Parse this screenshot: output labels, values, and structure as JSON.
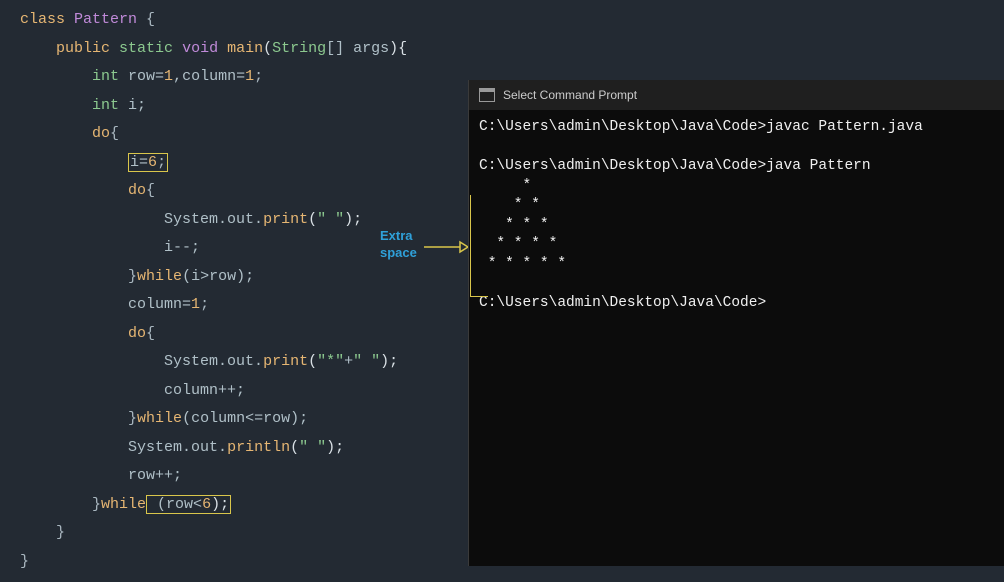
{
  "code": {
    "lines": {
      "l1_class": "class",
      "l1_name": "Pattern",
      "l1_brace": " {",
      "l2_public": "public",
      "l2_static": "static",
      "l2_void": "void",
      "l2_main": "main",
      "l2_arg_type": "String",
      "l2_arg_name": "[] args",
      "l3_int1": "int",
      "l3_vars": " row=",
      "l3_n1": "1",
      "l3_c": ",column=",
      "l3_n2": "1",
      "l3_semi": ";",
      "l4_int": "int",
      "l4_i": " i;",
      "l5_do": "do",
      "l5_brace": "{",
      "l6_assign": "i=",
      "l6_val": "6",
      "l6_semi": ";",
      "l7_do": "do",
      "l7_brace": "{",
      "l8_sys": "System.out.",
      "l8_print": "print",
      "l8_open": "(",
      "l8_str": "\" \"",
      "l8_close": ");",
      "l9_dec": "i--;",
      "l10_brace": "}",
      "l10_while": "while",
      "l10_cond": "(i>row);",
      "l11_col": "column=",
      "l11_n": "1",
      "l11_semi": ";",
      "l12_do": "do",
      "l12_brace": "{",
      "l13_sys": "System.out.",
      "l13_print": "print",
      "l13_open": "(",
      "l13_str1": "\"*\"",
      "l13_plus": "+",
      "l13_str2": "\" \"",
      "l13_close": ");",
      "l14_inc": "column++;",
      "l15_brace": "}",
      "l15_while": "while",
      "l15_cond": "(column<=row);",
      "l16_sys": "System.out.",
      "l16_println": "println",
      "l16_open": "(",
      "l16_str": "\" \"",
      "l16_close": ");",
      "l17_inc": "row++;",
      "l18_brace": "}",
      "l18_while": "while",
      "l18_cond": " (row<",
      "l18_n": "6",
      "l18_close": ");",
      "l19_brace": "}",
      "l20_brace": "}"
    }
  },
  "annotation": {
    "label_line1": "Extra",
    "label_line2": "space"
  },
  "terminal": {
    "title": "Select Command Prompt",
    "prompt_path": "C:\\Users\\admin\\Desktop\\Java\\Code>",
    "cmd1": "javac Pattern.java",
    "cmd2": "java Pattern",
    "out_line1": "     *",
    "out_line2": "    * *",
    "out_line3": "   * * *",
    "out_line4": "  * * * *",
    "out_line5": " * * * * *"
  }
}
